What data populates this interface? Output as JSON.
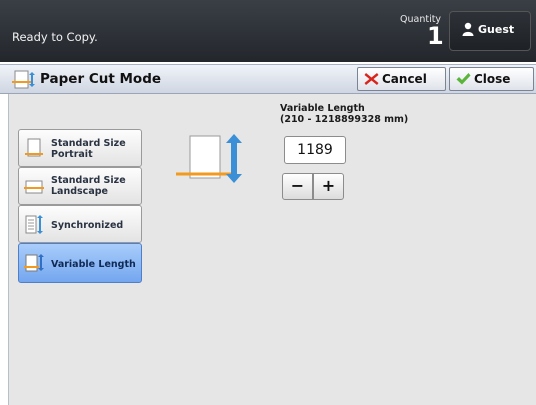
{
  "header": {
    "status": "Ready to Copy.",
    "quantity_label": "Quantity",
    "quantity_value": "1",
    "user_label": "Guest"
  },
  "titlebar": {
    "title": "Paper Cut Mode",
    "cancel_label": "Cancel",
    "close_label": "Close"
  },
  "options": {
    "standard_portrait": "Standard Size\nPortrait",
    "standard_landscape": "Standard Size\nLandscape",
    "synchronized": "Synchronized",
    "variable_length": "Variable Length",
    "selected": "Variable Length"
  },
  "variable_length": {
    "label": "Variable Length\n(210 - 1218899328 mm)",
    "value": "1189",
    "minus_label": "−",
    "plus_label": "+"
  },
  "colors": {
    "selected_option": "#74a6ef",
    "cut_line": "#f39a1e",
    "arrow": "#3a8fd6",
    "cancel_icon": "#d9241c",
    "close_icon": "#5bb53a"
  }
}
